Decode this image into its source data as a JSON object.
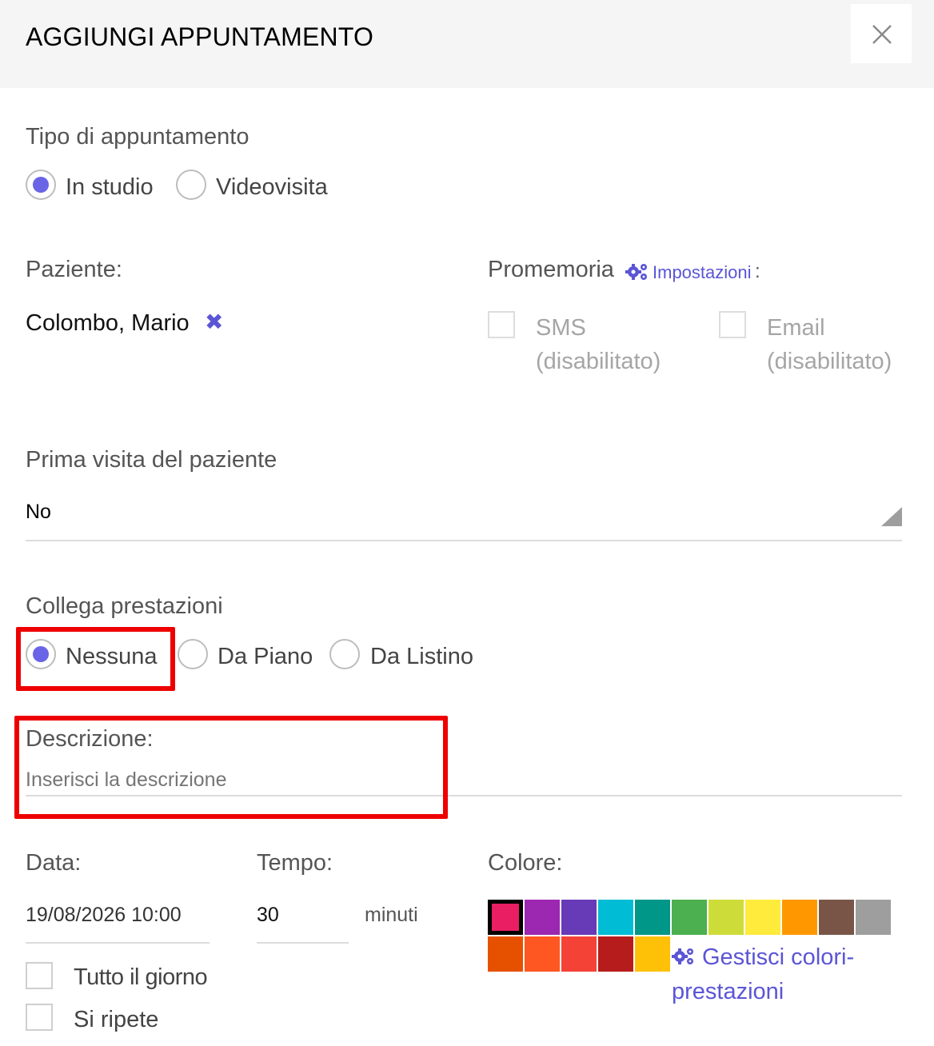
{
  "dialog": {
    "title": "AGGIUNGI APPUNTAMENTO",
    "close_glyph": "×"
  },
  "appointment_type": {
    "label": "Tipo di appuntamento",
    "options": [
      "In studio",
      "Videovisita"
    ],
    "selected": "In studio"
  },
  "patient": {
    "label": "Paziente:",
    "name": "Colombo, Mario",
    "remove_glyph": "✖"
  },
  "reminder": {
    "label": "Promemoria",
    "settings_link": "Impostazioni",
    "colon": ":",
    "sms_label": "SMS (disabilitato)",
    "email_label": "Email (disabilitato)"
  },
  "first_visit": {
    "label": "Prima visita del paziente",
    "value": "No"
  },
  "services": {
    "label": "Collega prestazioni",
    "options": [
      "Nessuna",
      "Da Piano",
      "Da Listino"
    ],
    "selected": "Nessuna"
  },
  "description": {
    "label": "Descrizione:",
    "placeholder": "Inserisci la descrizione"
  },
  "date": {
    "label": "Data:",
    "value": "19/08/2026 10:00"
  },
  "time": {
    "label": "Tempo:",
    "value": "30",
    "unit": "minuti"
  },
  "color": {
    "label": "Colore:",
    "manage_link": "Gestisci colori-prestazioni",
    "selected_index": 0,
    "swatches": [
      "#e91e63",
      "#9c27b0",
      "#673ab7",
      "#00bcd4",
      "#009688",
      "#4caf50",
      "#cddc39",
      "#ffeb3b",
      "#ff9800",
      "#795548",
      "#9e9e9e",
      "#e65100",
      "#ff5722",
      "#f44336",
      "#b71c1c",
      "#ffc107"
    ]
  },
  "options": {
    "all_day": "Tutto il giorno",
    "repeats": "Si ripete"
  }
}
